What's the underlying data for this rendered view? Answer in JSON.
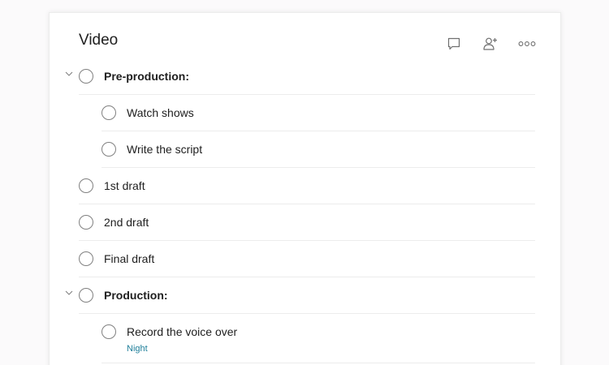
{
  "project": {
    "title": "Video"
  },
  "icons": {
    "comment": "comment-icon",
    "share": "add-person-icon",
    "more": "more-horizontal-icon",
    "collapse": "chevron-down-icon"
  },
  "colors": {
    "label_tag": "#1f7f9a",
    "divider": "#ececec",
    "checkbox_border": "#808080"
  },
  "tasks": [
    {
      "label": "Pre-production:",
      "type": "section",
      "level": 0
    },
    {
      "label": "Watch shows",
      "type": "task",
      "level": 1
    },
    {
      "label": "Write the script",
      "type": "task",
      "level": 1
    },
    {
      "label": "1st draft",
      "type": "task",
      "level": 0
    },
    {
      "label": "2nd draft",
      "type": "task",
      "level": 0
    },
    {
      "label": "Final draft",
      "type": "task",
      "level": 0
    },
    {
      "label": "Production:",
      "type": "section",
      "level": 0
    },
    {
      "label": "Record the voice over",
      "type": "task",
      "level": 1,
      "tag": "Night"
    }
  ]
}
